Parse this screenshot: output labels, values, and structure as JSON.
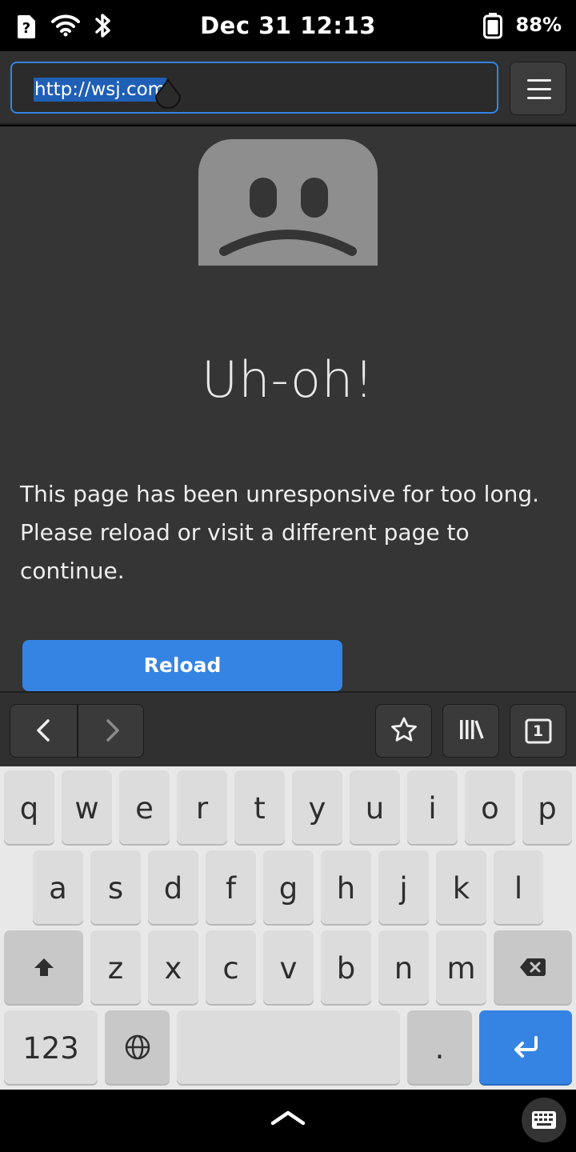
{
  "status_bar": {
    "time": "Dec 31  12:13",
    "battery_percent": "88%",
    "icons": [
      "sim-unknown-icon",
      "wifi-icon",
      "bluetooth-icon",
      "battery-icon"
    ]
  },
  "header": {
    "url": "http://wsj.com",
    "menu_icon": "hamburger-menu-icon"
  },
  "page": {
    "title": "Uh-oh!",
    "message": "This page has been unresponsive for too long. Please reload or visit a different page to continue.",
    "reload_label": "Reload"
  },
  "toolbar": {
    "icons": [
      "back-icon",
      "forward-icon",
      "bookmark-star-icon",
      "library-icon",
      "tabs-icon"
    ],
    "tab_count": "1"
  },
  "keyboard": {
    "row1": [
      "q",
      "w",
      "e",
      "r",
      "t",
      "y",
      "u",
      "i",
      "o",
      "p"
    ],
    "row2": [
      "a",
      "s",
      "d",
      "f",
      "g",
      "h",
      "j",
      "k",
      "l"
    ],
    "row3": [
      "z",
      "x",
      "c",
      "v",
      "b",
      "n",
      "m"
    ],
    "numbers_label": "123",
    "period_label": ".",
    "accent_color": "#3584e4"
  }
}
